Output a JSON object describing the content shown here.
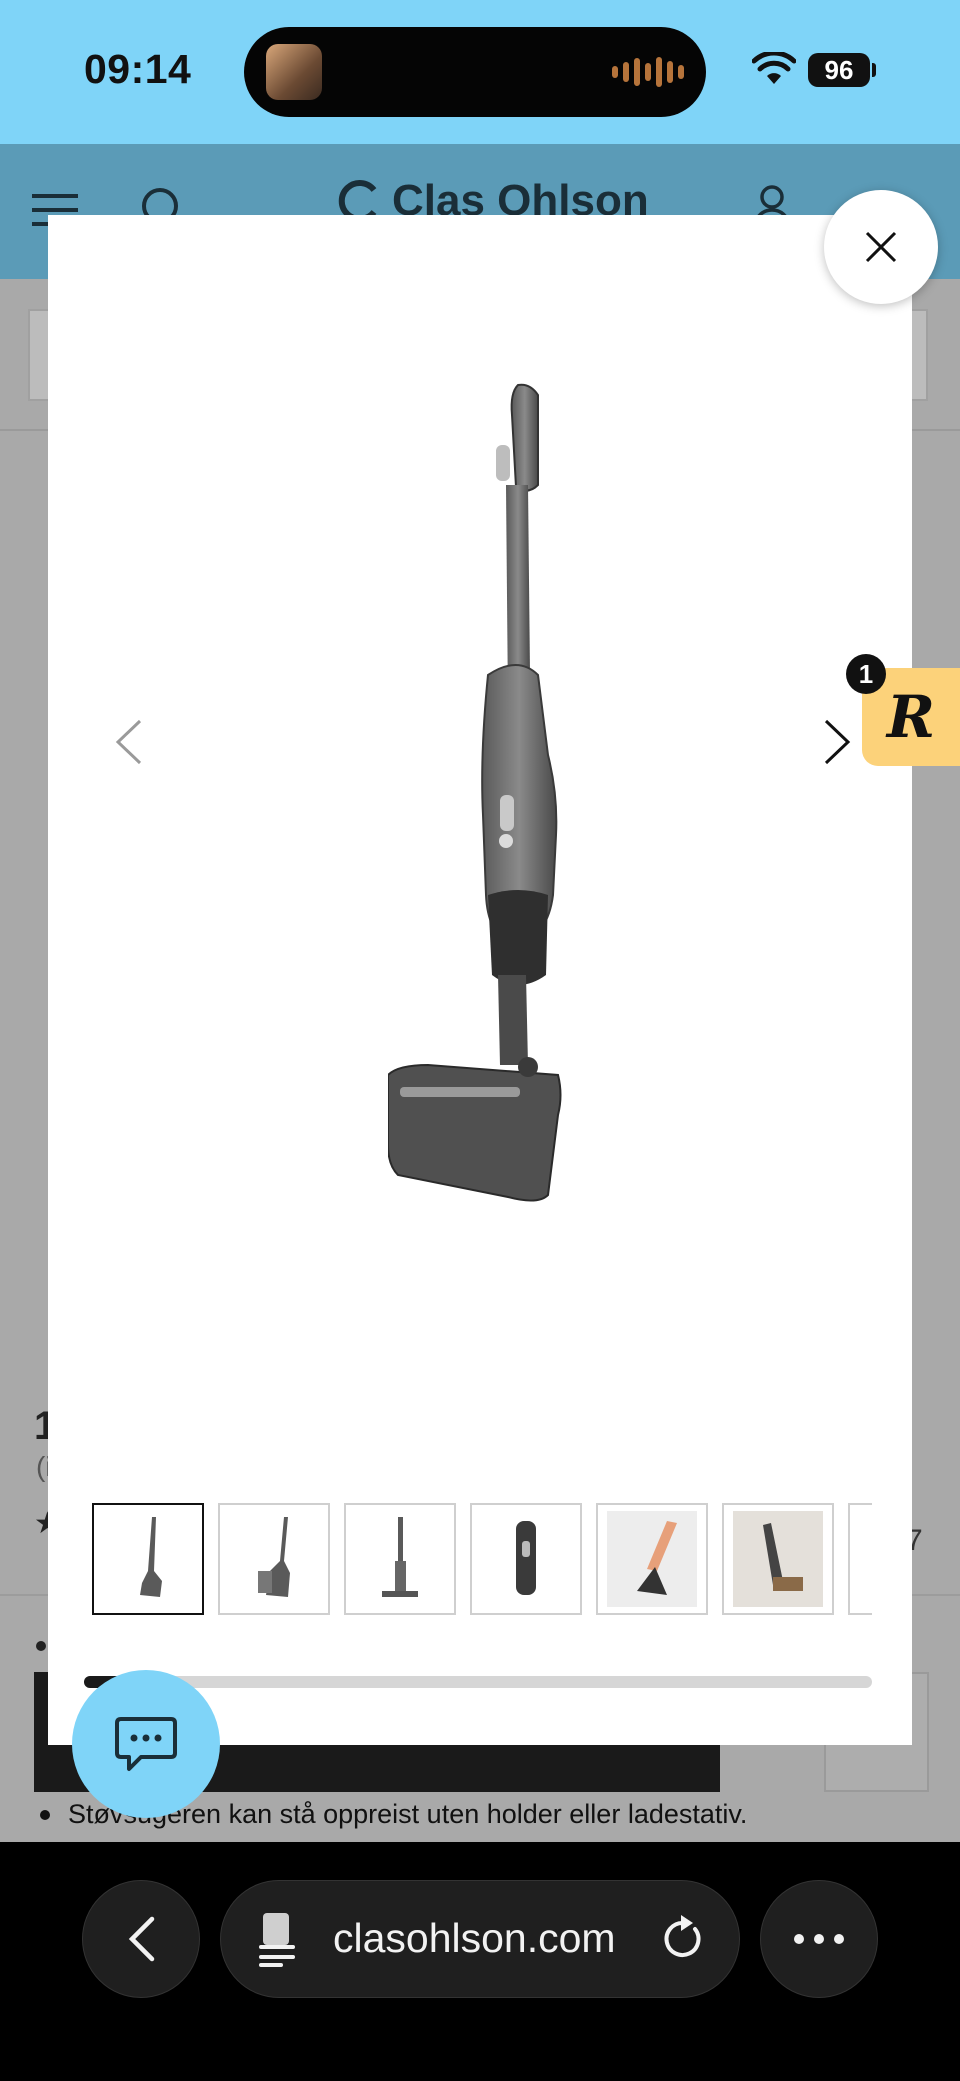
{
  "status_bar": {
    "time": "09:14",
    "battery": "96"
  },
  "site": {
    "logo_text": "Clas Ohlson",
    "title_fragment": "1",
    "subtitle_fragment": "(i",
    "rating_star": "★",
    "count_fragment": "7",
    "bullet_text": "Støvsugeren kan stå oppreist uten holder eller ladestativ.",
    "bullet_visible_text": "Stå​"
  },
  "gallery": {
    "thumbnails": [
      "thumb-1",
      "thumb-2",
      "thumb-3",
      "thumb-4",
      "thumb-5",
      "thumb-6",
      "thumb-7"
    ],
    "selected_index": 0,
    "scroll_progress": 0.1
  },
  "widget": {
    "badge_count": "1",
    "letter": "R"
  },
  "browser": {
    "url": "clasohlson.com"
  },
  "icons": {
    "close": "close-icon",
    "prev": "chevron-left-icon",
    "next": "chevron-right-icon",
    "chat": "chat-icon",
    "back": "back-icon",
    "reader": "reader-icon",
    "reload": "reload-icon",
    "more": "more-icon"
  },
  "colors": {
    "accent": "#7fd4f8",
    "header": "#5b9bb7",
    "widget": "#fcd27a"
  }
}
